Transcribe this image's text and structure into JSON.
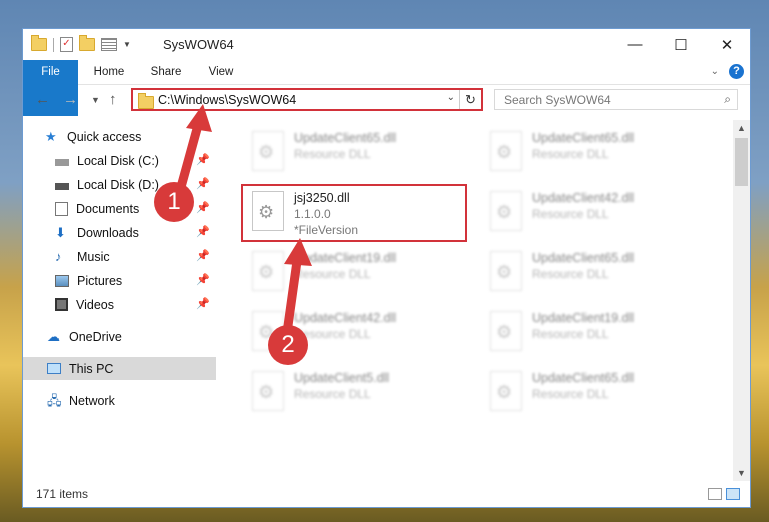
{
  "window": {
    "title": "SysWOW64"
  },
  "ribbon": {
    "tabs": [
      "File",
      "Home",
      "Share",
      "View"
    ]
  },
  "navbar": {
    "address": "C:\\Windows\\SysWOW64",
    "search_placeholder": "Search SysWOW64"
  },
  "sidebar": {
    "items": [
      {
        "label": "Quick access",
        "pinned": false
      },
      {
        "label": "Local Disk (C:)",
        "pinned": true
      },
      {
        "label": "Local Disk (D:)",
        "pinned": true
      },
      {
        "label": "Documents",
        "pinned": true
      },
      {
        "label": "Downloads",
        "pinned": true
      },
      {
        "label": "Music",
        "pinned": true
      },
      {
        "label": "Pictures",
        "pinned": true
      },
      {
        "label": "Videos",
        "pinned": true
      },
      {
        "label": "OneDrive",
        "pinned": false
      },
      {
        "label": "This PC",
        "pinned": false,
        "selected": true
      },
      {
        "label": "Network",
        "pinned": false
      }
    ]
  },
  "files": {
    "highlighted": {
      "name": "jsj3250.dll",
      "version": "1.1.0.0",
      "description": "*FileVersion"
    },
    "background": [
      {
        "name": "UpdateClient65.dll",
        "type": "Resource DLL"
      },
      {
        "name": "UpdateClient65.dll",
        "type": "Resource DLL"
      },
      {
        "name": "UpdateClient42.dll",
        "type": "Resource DLL"
      },
      {
        "name": "UpdateClient19.dll",
        "type": "Resource DLL"
      },
      {
        "name": "UpdateClient65.dll",
        "type": "Resource DLL"
      },
      {
        "name": "UpdateClient42.dll",
        "type": "Resource DLL"
      },
      {
        "name": "UpdateClient19.dll",
        "type": "Resource DLL"
      },
      {
        "name": "UpdateClient5.dll",
        "type": "Resource DLL"
      },
      {
        "name": "UpdateClient65.dll",
        "type": "Resource DLL"
      }
    ]
  },
  "status": {
    "item_count": "171 items"
  },
  "annotations": {
    "step1": "1",
    "step2": "2",
    "color": "#d83a3a"
  }
}
